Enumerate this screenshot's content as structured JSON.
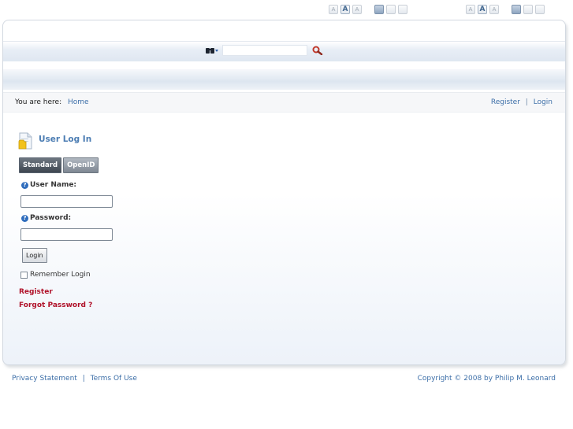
{
  "text_controls": {
    "size_left": [
      "A",
      "A",
      "A"
    ],
    "size_right": [
      "A",
      "A",
      "A"
    ]
  },
  "search": {
    "placeholder": ""
  },
  "breadcrumb": {
    "prefix": "You are here:",
    "home": "Home"
  },
  "top_links": {
    "register": "Register",
    "separator": "|",
    "login": "Login"
  },
  "module": {
    "title": "User Log In"
  },
  "tabs": [
    {
      "label": "Standard"
    },
    {
      "label": "OpenID"
    }
  ],
  "form": {
    "username_label": "User Name:",
    "password_label": "Password:",
    "login_button": "Login",
    "remember_label": "Remember Login",
    "register_link": "Register",
    "forgot_link": "Forgot Password ?"
  },
  "footer": {
    "privacy": "Privacy Statement",
    "separator": "|",
    "terms": "Terms Of Use",
    "copyright": "Copyright © 2008 by Philip M. Leonard"
  },
  "colors": {
    "link": "#3d6fa8",
    "red_link": "#b0122a",
    "title": "#4c7db3"
  }
}
